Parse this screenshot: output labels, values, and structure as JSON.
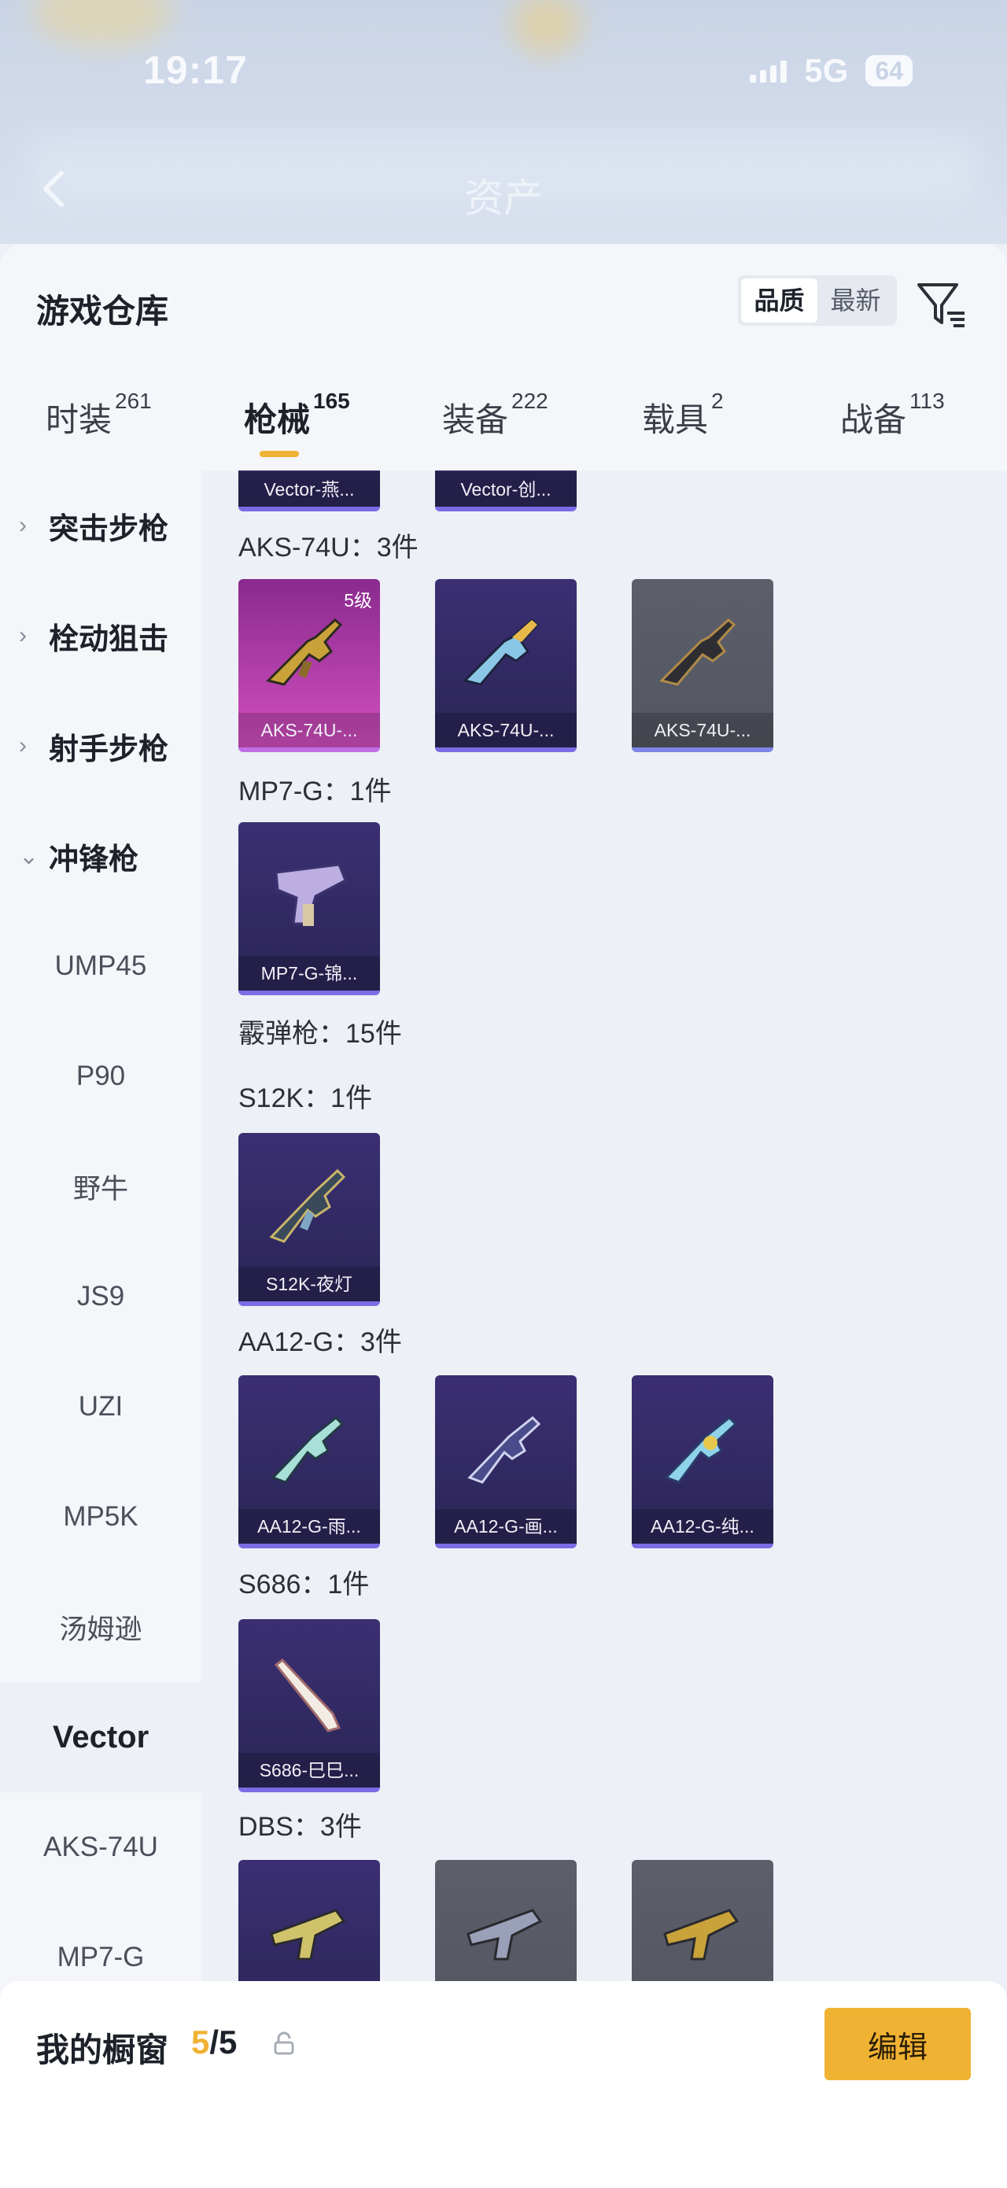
{
  "status_bar": {
    "time": "19:17",
    "network": "5G",
    "battery": "64"
  },
  "header": {
    "title": "资产"
  },
  "sheet": {
    "title": "游戏仓库"
  },
  "sort": {
    "options": [
      "品质",
      "最新"
    ],
    "active": "品质"
  },
  "tabs": [
    {
      "label": "时装",
      "count": "261"
    },
    {
      "label": "枪械",
      "count": "165",
      "active": true
    },
    {
      "label": "装备",
      "count": "222"
    },
    {
      "label": "载具",
      "count": "2"
    },
    {
      "label": "战备",
      "count": "113"
    }
  ],
  "sidebar": {
    "categories": [
      "突击步枪",
      "栓动狙击",
      "射手步枪",
      "冲锋枪"
    ],
    "subitems": [
      "UMP45",
      "P90",
      "野牛",
      "JS9",
      "UZI",
      "MP5K",
      "汤姆逊",
      "Vector",
      "AKS-74U",
      "MP7-G"
    ],
    "selected": "Vector"
  },
  "content": {
    "top_partial": [
      "Vector-燕...",
      "Vector-创..."
    ],
    "groups": [
      {
        "title": "AKS-74U：3件",
        "items": [
          {
            "label": "AKS-74U-...",
            "rarity": "pink",
            "level": "5级"
          },
          {
            "label": "AKS-74U-...",
            "rarity": "purple"
          },
          {
            "label": "AKS-74U-...",
            "rarity": "grey"
          }
        ]
      },
      {
        "title": "MP7-G：1件",
        "items": [
          {
            "label": "MP7-G-锦...",
            "rarity": "purple"
          }
        ]
      },
      {
        "title": "霰弹枪：15件",
        "items": []
      },
      {
        "title": "S12K：1件",
        "items": [
          {
            "label": "S12K-夜灯",
            "rarity": "purple"
          }
        ]
      },
      {
        "title": "AA12-G：3件",
        "items": [
          {
            "label": "AA12-G-雨...",
            "rarity": "purple"
          },
          {
            "label": "AA12-G-画...",
            "rarity": "purple"
          },
          {
            "label": "AA12-G-纯...",
            "rarity": "purple"
          }
        ]
      },
      {
        "title": "S686：1件",
        "items": [
          {
            "label": "S686-巳巳...",
            "rarity": "purple"
          }
        ]
      },
      {
        "title": "DBS：3件",
        "items": [
          {
            "rarity": "purple"
          },
          {
            "rarity": "grey"
          },
          {
            "rarity": "grey"
          }
        ]
      }
    ]
  },
  "showcase": {
    "label": "我的橱窗",
    "count_used": "5",
    "count_total": "/5",
    "edit_label": "编辑"
  },
  "colors": {
    "accent": "#f0b233",
    "purple": "#3b2f73",
    "pink": "#c94fbc",
    "grey": "#5c5f6a"
  },
  "icons": [
    "back-icon",
    "filter-icon",
    "lock-icon",
    "share-icon",
    "chevron-right-icon",
    "chevron-down-icon"
  ]
}
